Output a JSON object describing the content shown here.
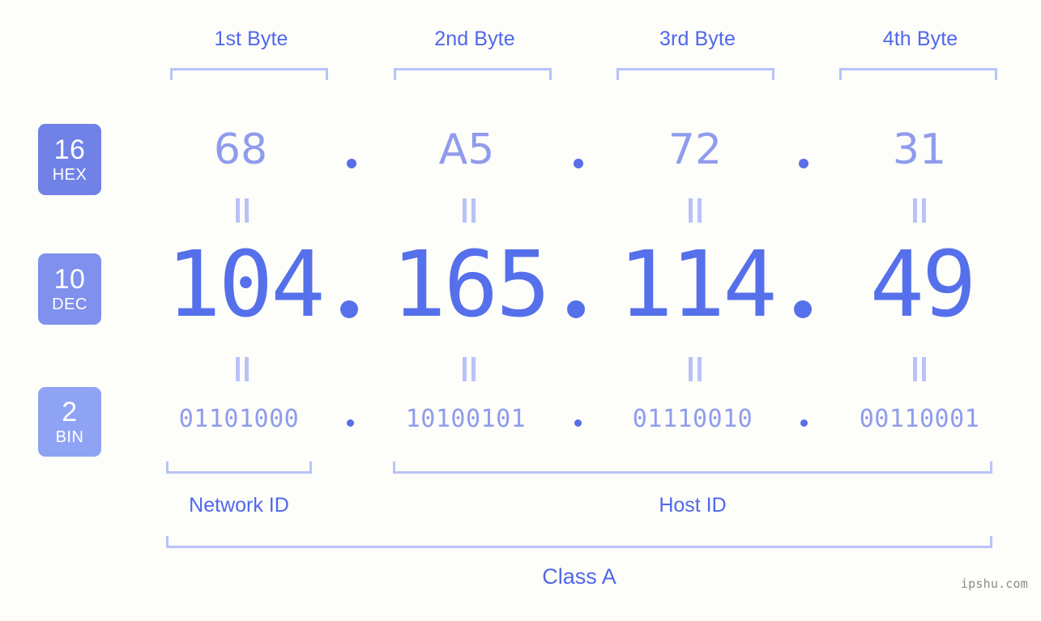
{
  "meta": {
    "watermark": "ipshu.com"
  },
  "byte_headers": [
    {
      "label": "1st Byte"
    },
    {
      "label": "2nd Byte"
    },
    {
      "label": "3rd Byte"
    },
    {
      "label": "4th Byte"
    }
  ],
  "rows": {
    "hex": {
      "badge_num": "16",
      "badge_unit": "HEX",
      "values": [
        "68",
        "A5",
        "72",
        "31"
      ],
      "separator": "."
    },
    "dec": {
      "badge_num": "10",
      "badge_unit": "DEC",
      "values": [
        "104",
        "165",
        "114",
        "49"
      ],
      "separator": "."
    },
    "bin": {
      "badge_num": "2",
      "badge_unit": "BIN",
      "values": [
        "01101000",
        "10100101",
        "01110010",
        "00110001"
      ],
      "separator": "."
    }
  },
  "regions": {
    "network_id": "Network ID",
    "host_id": "Host ID",
    "class": "Class A"
  },
  "colors": {
    "background": "#fdfdfa",
    "label_blue": "#5068ea",
    "bracket_blue": "#b9c3f8",
    "hex_text": "#8f9ced",
    "dec_text": "#5570ea",
    "bin_text": "#8f9ced",
    "badge_hex": "#7182e6",
    "badge_dec": "#8090ed",
    "badge_bin": "#8fa3f4",
    "dot_blue": "#5a6ee8",
    "watermark_gray": "#8a8a8a"
  }
}
